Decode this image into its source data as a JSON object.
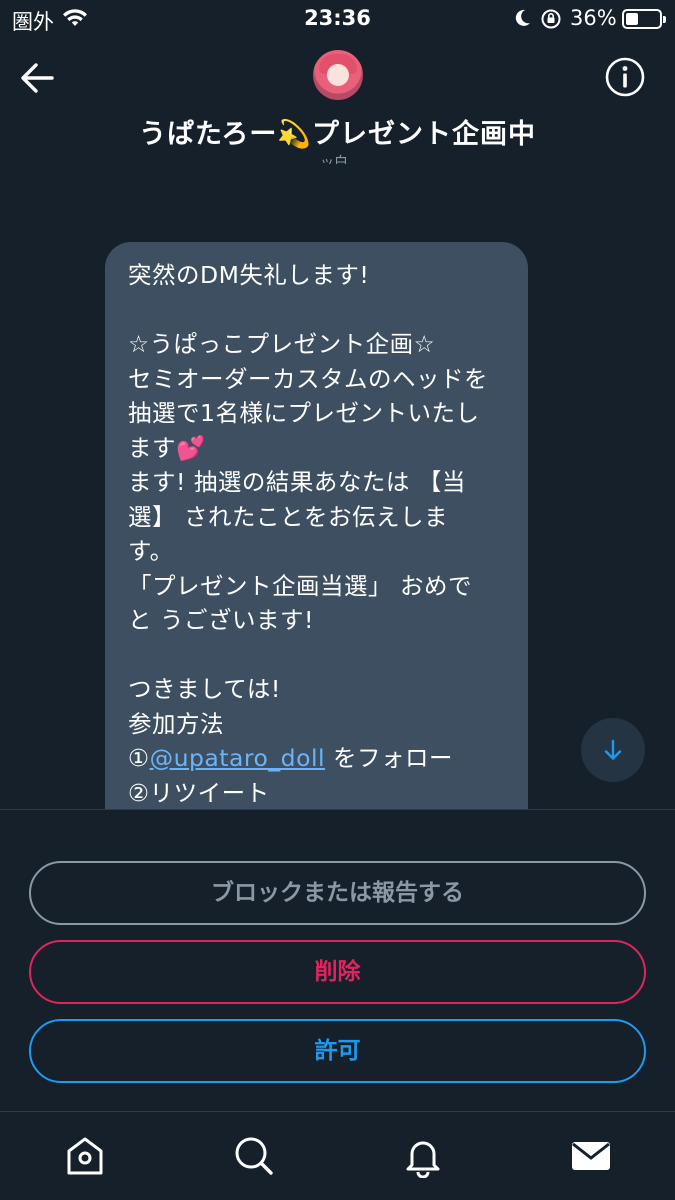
{
  "status_bar": {
    "carrier": "圏外",
    "time": "23:36",
    "battery_percent": "36%",
    "battery_level": 0.36
  },
  "header": {
    "title": "うぱたろー💫プレゼント企画中",
    "subtitle_fragment": "ッ白",
    "icons": {
      "back": "back-arrow-icon",
      "info": "info-icon",
      "avatar": "avatar"
    }
  },
  "message": {
    "lines": [
      "突然のDM失礼します!",
      "",
      "☆うぱっこプレゼント企画☆",
      "セミオーダーカスタムのヘッドを",
      "抽選で1名様にプレゼントいたし",
      "ます💕",
      "ます! 抽選の結果あなたは 【当",
      "選】 されたことをお伝えしま",
      "す。",
      "「プレゼント企画当選」 おめで",
      "と うございます!",
      "",
      "つきましては!",
      "参加方法"
    ],
    "step1_prefix": "①",
    "step1_mention": "@upataro_doll",
    "step1_suffix": " をフォロー",
    "step2": "②リツイート"
  },
  "actions": {
    "block_report_label": "ブロックまたは報告する",
    "delete_label": "削除",
    "allow_label": "許可"
  },
  "tab_bar": {
    "tabs": [
      {
        "name": "home",
        "icon": "home-icon"
      },
      {
        "name": "search",
        "icon": "search-icon"
      },
      {
        "name": "notifications",
        "icon": "bell-icon"
      },
      {
        "name": "messages",
        "icon": "mail-icon",
        "active": true
      }
    ]
  },
  "colors": {
    "background": "#15202b",
    "bubble": "#3d4f61",
    "link": "#6cb4f5",
    "danger": "#e0245e",
    "primary": "#1d9bf0",
    "muted": "#8b98a5"
  }
}
